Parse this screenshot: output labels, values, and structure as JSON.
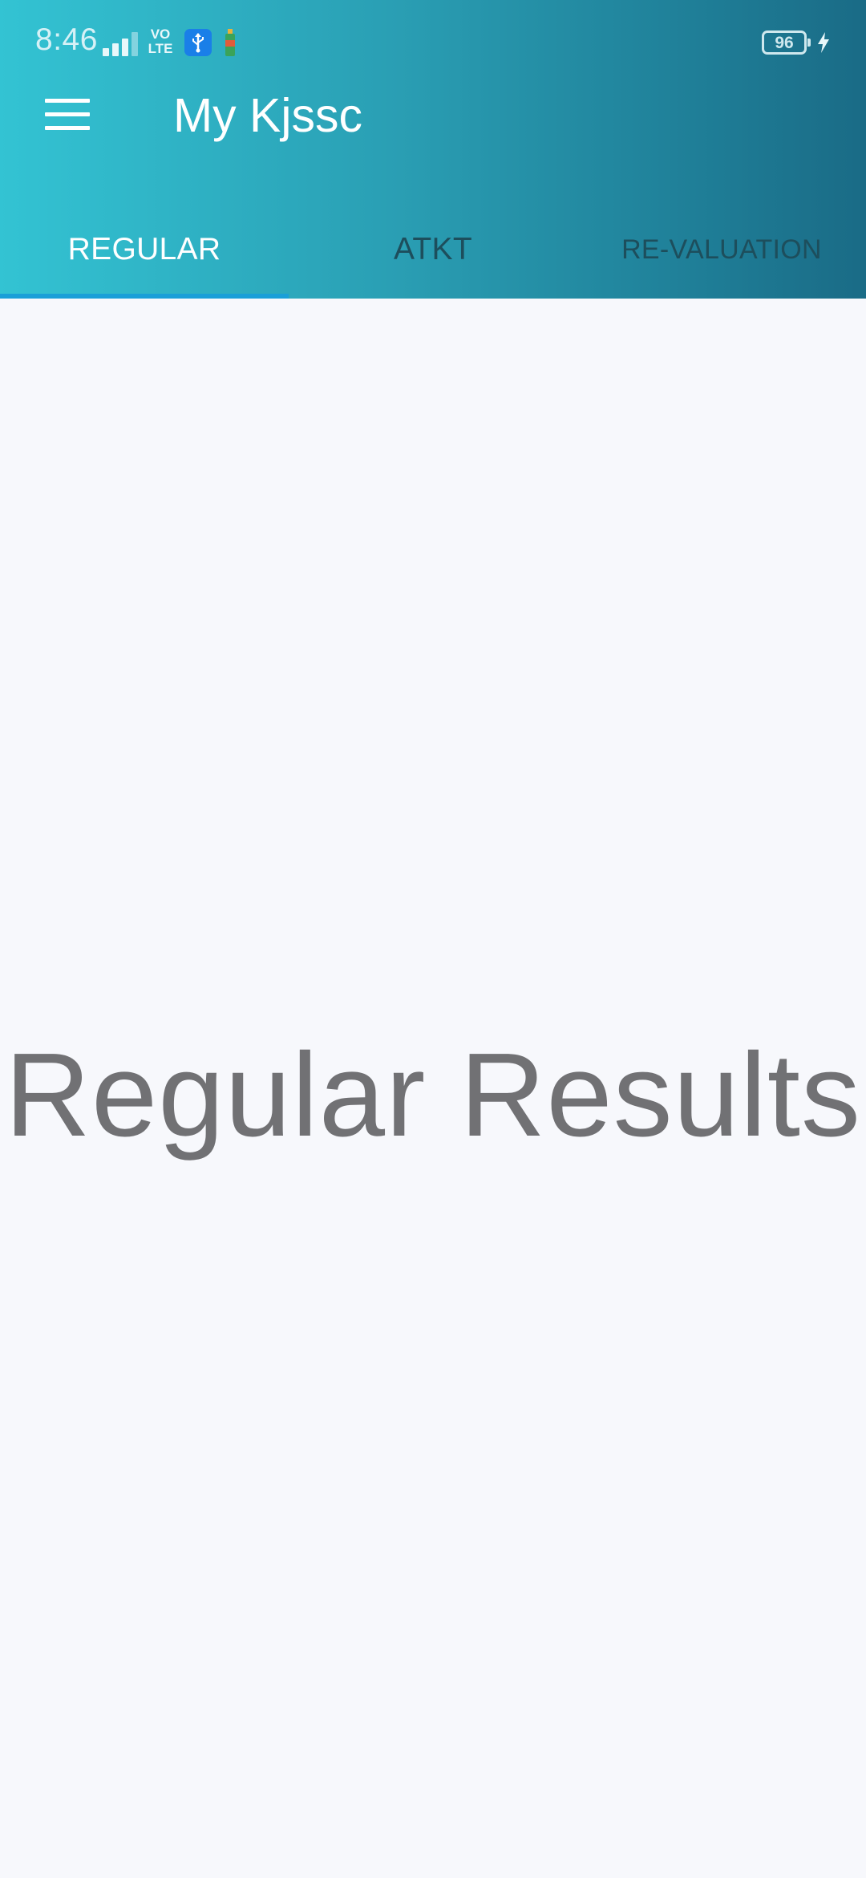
{
  "status_bar": {
    "time": "8:46",
    "network_label_top": "VO",
    "network_label_bottom": "LTE",
    "battery_level": "96",
    "icons": [
      "signal-icon",
      "volte-icon",
      "usb-icon",
      "bottle-icon",
      "battery-icon",
      "charging-bolt-icon"
    ]
  },
  "app_bar": {
    "title": "My Kjssc",
    "menu_icon": "hamburger-menu-icon"
  },
  "tabs": [
    {
      "label": "REGULAR",
      "active": true
    },
    {
      "label": "ATKT",
      "active": false
    },
    {
      "label": "RE-VALUATION",
      "active": false
    }
  ],
  "main": {
    "heading": "Regular Results"
  },
  "colors": {
    "gradient_start": "#33c3d3",
    "gradient_end": "#1a6b86",
    "tab_indicator": "#1a9fd8",
    "inactive_tab_text": "#1d4e5c",
    "background": "#f7f8fc",
    "heading_text": "#717174"
  }
}
